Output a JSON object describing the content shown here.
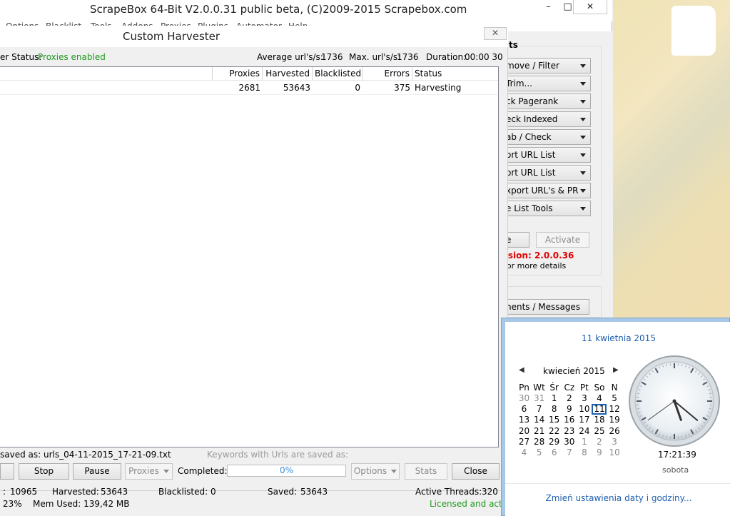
{
  "main_window": {
    "title": "ScrapeBox 64-Bit V2.0.0.31 public beta, (C)2009-2015 Scrapebox.com",
    "caption_buttons": {
      "minimize": "–",
      "maximize": "□",
      "close": "✕"
    },
    "menu_fragments": [
      "Options",
      "Blacklist",
      "Tools",
      "Addons",
      "Proxies",
      "Plugins",
      "Automator",
      "Help"
    ]
  },
  "right_panel": {
    "title": "ts",
    "dropdowns": [
      "move / Filter",
      "Trim...",
      "ck Pagerank",
      "eck Indexed",
      "ab / Check",
      "ort URL List",
      "ort URL List",
      "xport URL's & PR",
      "e List Tools"
    ],
    "e_button": "e",
    "activate_button": "Activate",
    "version": "rsion:  2.0.0.36",
    "details": "for more details",
    "messages_button": "nents / Messages"
  },
  "harvester": {
    "title": "Custom Harvester",
    "close": "✕",
    "server_status_label": "er Status:",
    "server_status_value": "Proxies enabled",
    "avg_label": "Average url's/s:",
    "avg_value": "1736",
    "max_label": "Max. url's/s:",
    "max_value": "1736",
    "duration_label": "Duration:",
    "duration_value": "00:00 30",
    "table": {
      "columns": [
        "Proxies",
        "Harvested",
        "Blacklisted",
        "Errors",
        "Status"
      ],
      "rows": [
        {
          "proxies": "2681",
          "harvested": "53643",
          "blacklisted": "0",
          "errors": "375",
          "status": "Harvesting"
        }
      ]
    },
    "saved_as": "saved as: urls_04-11-2015_17-21-09.txt",
    "keywords_saved": "Keywords with Urls are saved as:",
    "buttons": {
      "stop": "Stop",
      "pause": "Pause",
      "proxies": "Proxies",
      "options": "Options",
      "stats": "Stats",
      "close": "Close"
    },
    "completed_label": "Completed:",
    "progress": "0%",
    "bottom": {
      "count_label": ":",
      "count_value": "10965",
      "harvested_label": "Harvested:",
      "harvested_value": "53643",
      "blacklisted_label": "Blacklisted:",
      "blacklisted_value": "0",
      "saved_label": "Saved:",
      "saved_value": "53643",
      "threads_label": "Active Threads:",
      "threads_value": "320"
    }
  },
  "memory_bar": {
    "cpu": "23%",
    "mem": "Mem Used: 139,42 MB",
    "license": "Licensed and acti"
  },
  "calendar": {
    "date_header": "11 kwietnia 2015",
    "month": "kwiecień 2015",
    "prev": "◀",
    "next": "▶",
    "weekdays": [
      "Pn",
      "Wt",
      "Śr",
      "Cz",
      "Pt",
      "So",
      "N"
    ],
    "weeks": [
      [
        "30",
        "31",
        "1",
        "2",
        "3",
        "4",
        "5"
      ],
      [
        "6",
        "7",
        "8",
        "9",
        "10",
        "11",
        "12"
      ],
      [
        "13",
        "14",
        "15",
        "16",
        "17",
        "18",
        "19"
      ],
      [
        "20",
        "21",
        "22",
        "23",
        "24",
        "25",
        "26"
      ],
      [
        "27",
        "28",
        "29",
        "30",
        "1",
        "2",
        "3"
      ],
      [
        "4",
        "5",
        "6",
        "7",
        "8",
        "9",
        "10"
      ]
    ],
    "time": "17:21:39",
    "day_name": "sobota",
    "change_link": "Zmień ustawienia daty i godziny..."
  }
}
